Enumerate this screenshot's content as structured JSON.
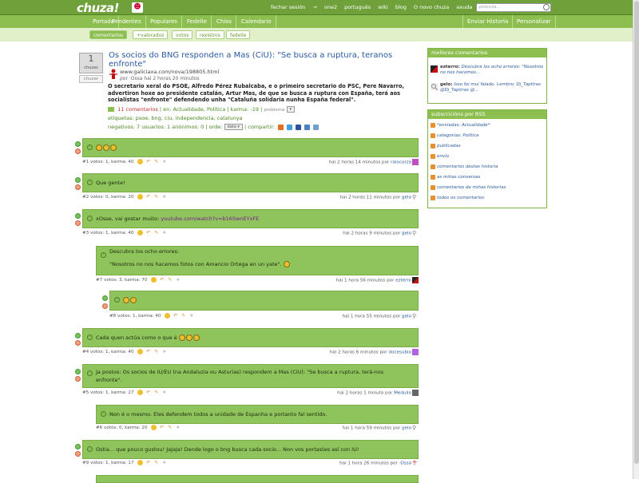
{
  "topbar": {
    "logo": "chuza!",
    "links": [
      "fechar sesión",
      "→",
      "one2",
      "português",
      "wiki",
      "blog",
      "O novo chuza",
      "axuda"
    ],
    "search_placeholder": "procura..."
  },
  "nav": {
    "items": [
      "Portada",
      "Pendentes",
      "Populares",
      "Fedelle",
      "Chíos",
      "Calendario"
    ],
    "right_items": [
      "Enviar Historia",
      "Personalizar"
    ]
  },
  "subnav": {
    "tabs": [
      "comentarios",
      "+valorados",
      "votos",
      "rexistros",
      "fedelle"
    ]
  },
  "story": {
    "votes": "1",
    "votes_label": "chuzas",
    "vote_button": "chuzar",
    "title": "Os socios do BNG responden a Mas (CiU): \"Se busca a ruptura, teranos enfronte\"",
    "url": "www.galiciaxa.com/nova/198805.html",
    "byline": "por ·Ossa hai 2 horas 20 minutos",
    "text": "O secretario xeral do PSOE, Alfredo Pérez Rubalcaba, e o primeiro secretario do PSC, Pere Navarro, advertiron hoxe ao presidente catalán, Artur Mas, de que se busca a ruptura con España, terá aos socialistas \"enfronte\" defendendo unha \"Cataluña solidaria nunha España federal\".",
    "comments": "11 comentarios",
    "category": "en: Actualidade, Política",
    "karma": "karma: -19",
    "problem": "problema",
    "tags": "etiquetas: psoe, bng, ciu, independencia, catalunya",
    "negatives": "negativos: 7 usuarios: 1 anónimos: 0",
    "order": "orde:",
    "order_value": "data",
    "share": "compartir:"
  },
  "comments": [
    {
      "num": "#1",
      "text": "",
      "smileys": 3,
      "votes": "votos: 1, karma: 40",
      "time": "hai 2 horas 14 minutos por",
      "user": "raiocorza"
    },
    {
      "num": "#2",
      "text": "Que gente!",
      "smileys": 0,
      "votes": "votos: 0, karma: 20",
      "time": "hai 2 horas 11 minutos por",
      "user": "gelo"
    },
    {
      "num": "#3",
      "text": "xOsse, vai gostar muito:",
      "link": "youtube.com/watch?v=b16SwnEYxFE",
      "smileys": 0,
      "votes": "votos: 1, karma: 40",
      "time": "hai 2 horas 9 minutos por",
      "user": "gelo"
    },
    {
      "num": "#7",
      "text_lines": [
        "Descubra los ocho errores:",
        "\"Nosotros no nos hacemos fotos con Amancio Ortega en un yate\"."
      ],
      "votes": "votos: 3, karma: 70",
      "time": "hai 1 hora 56 minutos por",
      "user": "ezterro"
    },
    {
      "num": "#8",
      "text": "",
      "smileys": 2,
      "votes": "votos: 1, karma: 40",
      "time": "hai 1 hora 55 minutos por",
      "user": "gelo"
    },
    {
      "num": "#4",
      "text": "Cada quen actúa como o que é",
      "smileys": 3,
      "votes": "votos: 1, karma: 40",
      "time": "hai 2 horas 6 minutos por",
      "user": "docesubio"
    },
    {
      "num": "#5",
      "text_lines": [
        "Ja postos: Os socios de IU/EU (na Andaluzia ou Asturias) respondem a Mas (CiU): \"Se busca a ruptura, terá-nos",
        "enfronte\"."
      ],
      "votes": "votos: 1, karma: 27",
      "time": "hai 2 horas 1 minuto por",
      "user": "Meduilo"
    },
    {
      "num": "#6",
      "text": "Non é o mesmo. Eles defendem todos a unidade de Espanha e portanto fal sentido.",
      "votes": "votos: 0, karma: 20",
      "time": "hai 1 hora 59 minutos por",
      "user": "gelo"
    },
    {
      "num": "#9",
      "text": "Ostia... que pouco gustou! JaJaJa! Dende logo o bng busca cada socio... Non vos portastes así con IU!",
      "votes": "votos: 1, karma: 17",
      "time": "hai 1 hora 26 minutos por",
      "user": "·Ossa"
    }
  ],
  "sidebar": {
    "best_title": "mellores comentarios",
    "best": [
      {
        "user": "ezterro:",
        "text": "Descubra los ocho errores: \"Nosotros no nos hacemos..."
      },
      {
        "user": "gelo:",
        "text": "Isso foi mui falado. Lembro: Dj_Tapitras @Dj_Tapitras @..."
      }
    ],
    "rss_title": "subscricións por RSS",
    "rss": [
      "*enviadas: Actualidade*",
      "categorías: Política",
      "publicadas",
      "envío",
      "comentarios destas historia",
      "as miñas conversas",
      "comentarios de miñas historias",
      "todos os comentarios"
    ]
  },
  "colors": {
    "topbar": "#6fa03a",
    "nav": "#8cbf4f",
    "comment_bg": "#8fc45c",
    "link": "#2a5aa0"
  }
}
